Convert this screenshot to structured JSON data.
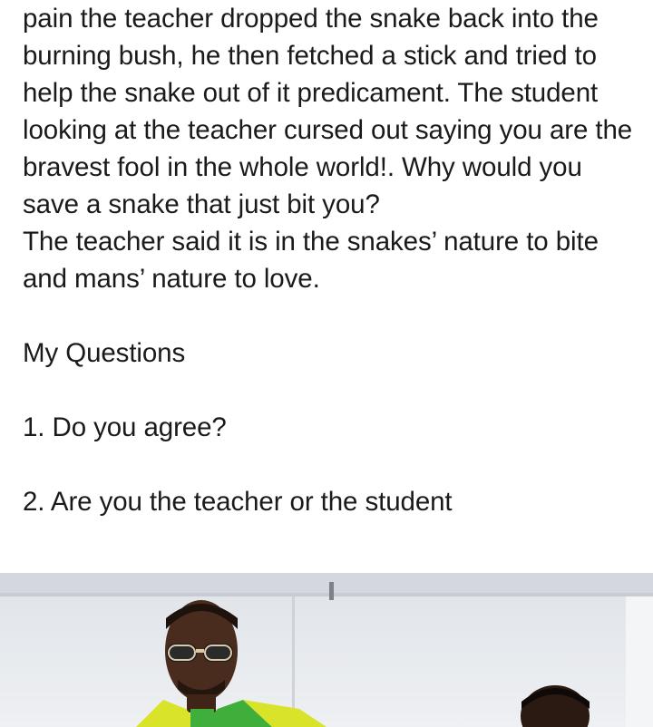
{
  "post": {
    "paragraphs": {
      "story": "pain the teacher dropped the snake back into the burning bush, he then fetched a stick and tried to help the snake out of it predicament. The student looking at the teacher cursed out saying you are the bravest fool in the whole world!. Why would you save a snake that just bit you?",
      "answer": "The teacher said it is in the snakes’ nature to bite and mans’ nature to love.",
      "heading": "My Questions",
      "question_1": "1. Do you agree?",
      "question_2": "2. Are you the teacher or the student"
    }
  },
  "colors": {
    "text": "#1a1a1a",
    "background": "#ffffff",
    "photo_wall": "#e8eaee",
    "jacket_green": "#3fae3a",
    "jacket_yellow": "#d9e32a",
    "skin": "#4a2c1e"
  }
}
